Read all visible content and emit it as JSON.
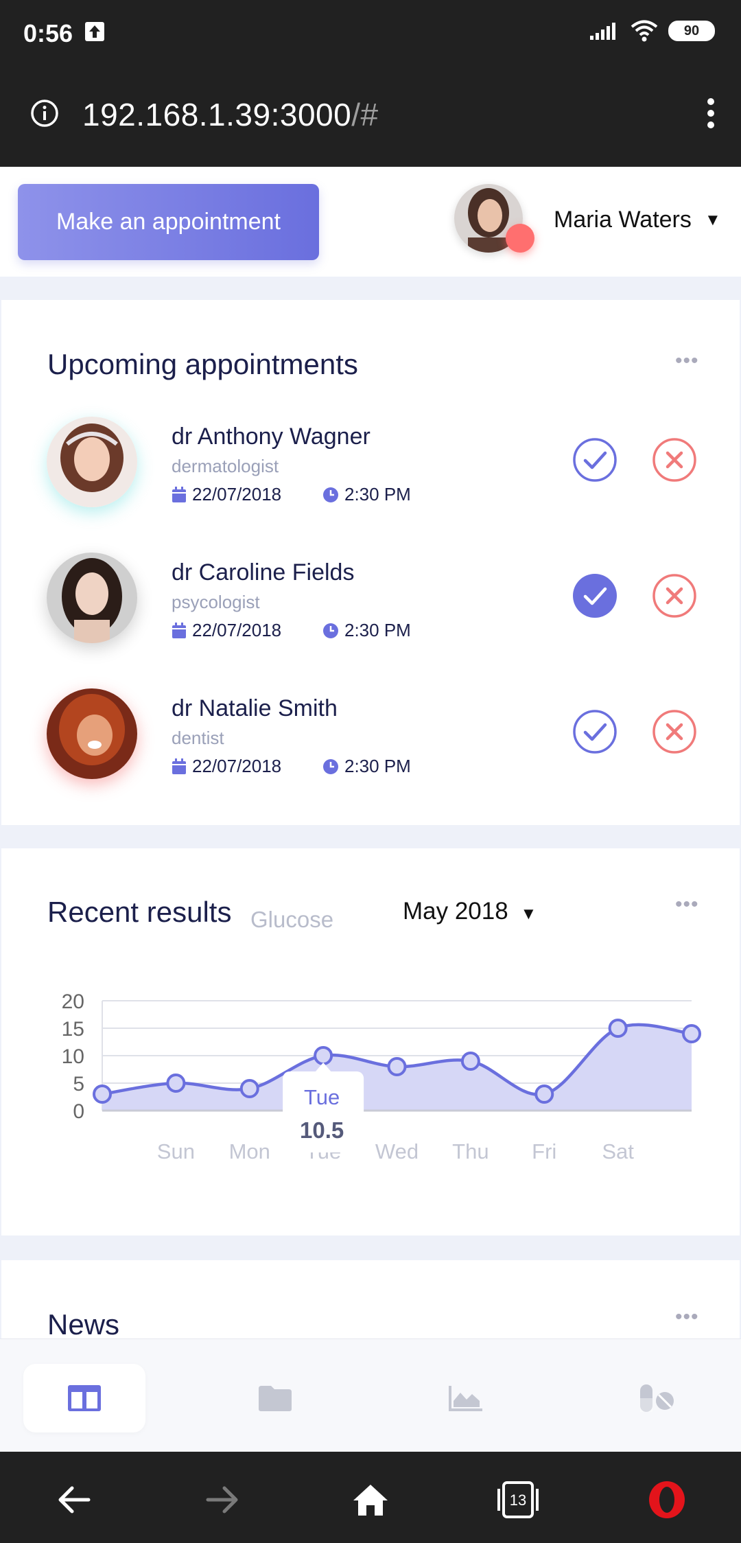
{
  "status_bar": {
    "time": "0:56",
    "battery": "90"
  },
  "browser": {
    "url_host": "192.168.1.39:3000",
    "url_path": "/#"
  },
  "header": {
    "appointment_button": "Make an appointment",
    "user_name": "Maria Waters",
    "caret": "▼"
  },
  "appointments": {
    "title": "Upcoming appointments",
    "more": "•••",
    "items": [
      {
        "name": "dr Anthony Wagner",
        "specialty": "dermatologist",
        "date": "22/07/2018",
        "time": "2:30 PM",
        "confirmed": false
      },
      {
        "name": "dr Caroline Fields",
        "specialty": "psycologist",
        "date": "22/07/2018",
        "time": "2:30 PM",
        "confirmed": true
      },
      {
        "name": "dr Natalie Smith",
        "specialty": "dentist",
        "date": "22/07/2018",
        "time": "2:30 PM",
        "confirmed": false
      }
    ]
  },
  "results": {
    "title": "Recent results",
    "subtitle": "Glucose",
    "month": "May 2018",
    "caret": "▼",
    "more": "•••",
    "tooltip": {
      "day": "Tue",
      "value": "10.5"
    }
  },
  "news": {
    "title": "News",
    "more": "•••"
  },
  "colors": {
    "accent": "#6a6fde",
    "danger": "#f07a7a",
    "dark": "#212121"
  },
  "chart_data": {
    "type": "area",
    "x": [
      "",
      "Sun",
      "Mon",
      "Tue",
      "Wed",
      "Thu",
      "Fri",
      "Sat",
      ""
    ],
    "values": [
      3,
      5,
      4,
      10,
      8,
      9,
      3,
      15,
      14
    ],
    "yticks": [
      0,
      5,
      10,
      15,
      20
    ],
    "ylim": [
      0,
      20
    ],
    "grid": true
  },
  "nav": {
    "items": [
      "dashboard-icon",
      "folder-icon",
      "chart-icon",
      "pills-icon"
    ],
    "tabs_count": "13"
  }
}
